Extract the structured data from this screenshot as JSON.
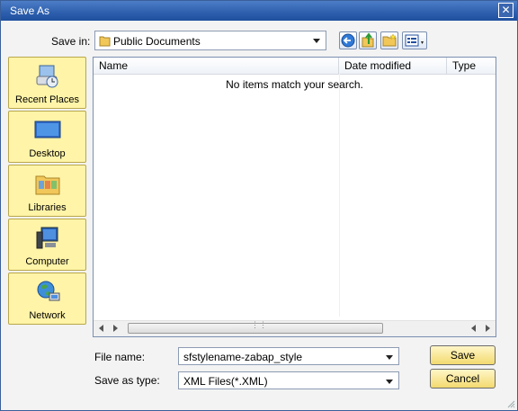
{
  "window": {
    "title": "Save As"
  },
  "save_in": {
    "label": "Save in:",
    "value": "Public Documents"
  },
  "places": [
    {
      "label": "Recent Places",
      "icon": "recent-places-icon"
    },
    {
      "label": "Desktop",
      "icon": "desktop-icon"
    },
    {
      "label": "Libraries",
      "icon": "libraries-icon"
    },
    {
      "label": "Computer",
      "icon": "computer-icon"
    },
    {
      "label": "Network",
      "icon": "network-icon"
    }
  ],
  "file_list": {
    "columns": [
      "Name",
      "Date modified",
      "Type"
    ],
    "empty_message": "No items match your search."
  },
  "file_name": {
    "label": "File name:",
    "value": "sfstylename-zabap_style"
  },
  "save_as_type": {
    "label": "Save as type:",
    "value": "XML Files(*.XML)"
  },
  "buttons": {
    "save": "Save",
    "cancel": "Cancel"
  },
  "colors": {
    "title_bar": "#2d5fae",
    "place_bg": "#fff4a8",
    "button_bg": "#f3da6f"
  }
}
